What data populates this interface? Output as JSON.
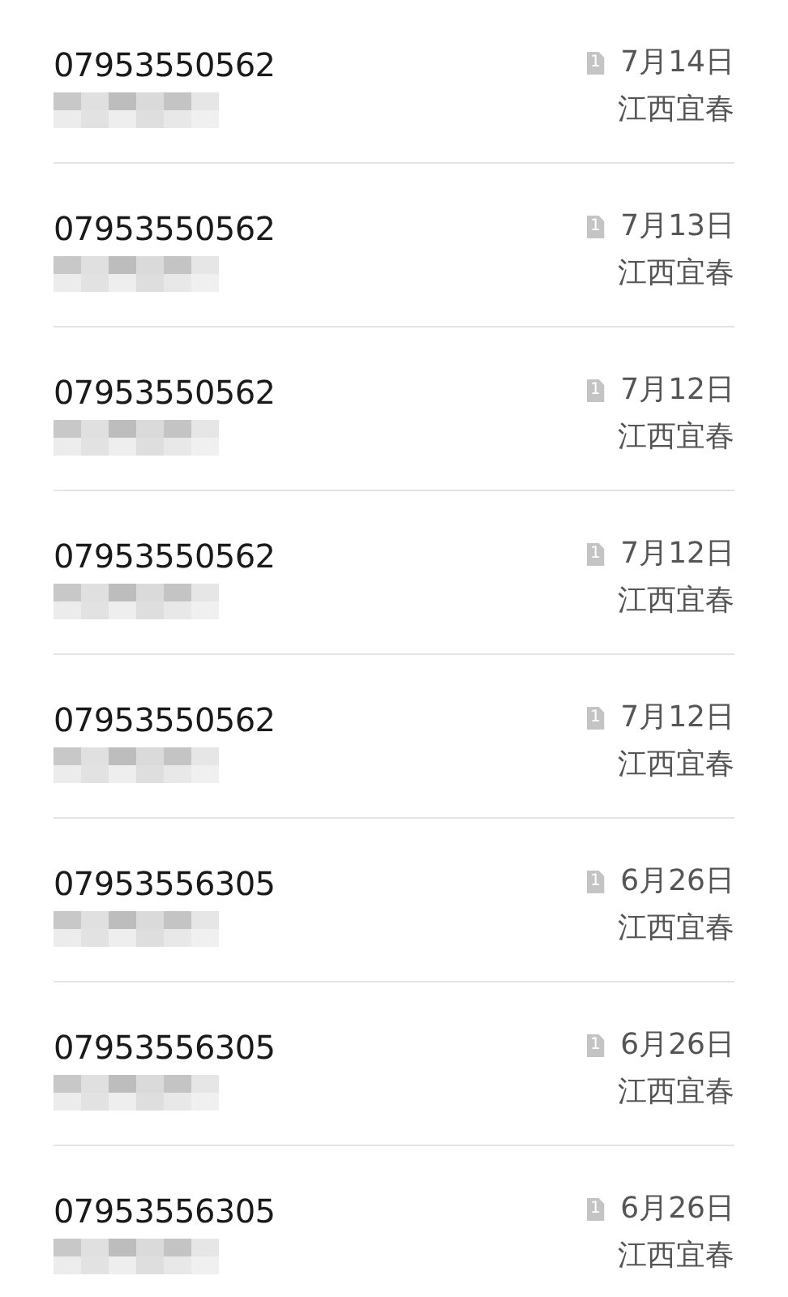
{
  "calls": [
    {
      "number": "07953550562",
      "detail_blurred": true,
      "sim": "1",
      "date": "7月14日",
      "location": "江西宜春"
    },
    {
      "number": "07953550562",
      "detail_blurred": true,
      "sim": "1",
      "date": "7月13日",
      "location": "江西宜春"
    },
    {
      "number": "07953550562",
      "detail_blurred": true,
      "sim": "1",
      "date": "7月12日",
      "location": "江西宜春"
    },
    {
      "number": "07953550562",
      "detail_blurred": true,
      "sim": "1",
      "date": "7月12日",
      "location": "江西宜春"
    },
    {
      "number": "07953550562",
      "detail_blurred": true,
      "sim": "1",
      "date": "7月12日",
      "location": "江西宜春"
    },
    {
      "number": "07953556305",
      "detail_blurred": true,
      "sim": "1",
      "date": "6月26日",
      "location": "江西宜春"
    },
    {
      "number": "07953556305",
      "detail_blurred": true,
      "sim": "1",
      "date": "6月26日",
      "location": "江西宜春"
    },
    {
      "number": "07953556305",
      "detail_blurred": true,
      "sim": "1",
      "date": "6月26日",
      "location": "江西宜春"
    }
  ]
}
